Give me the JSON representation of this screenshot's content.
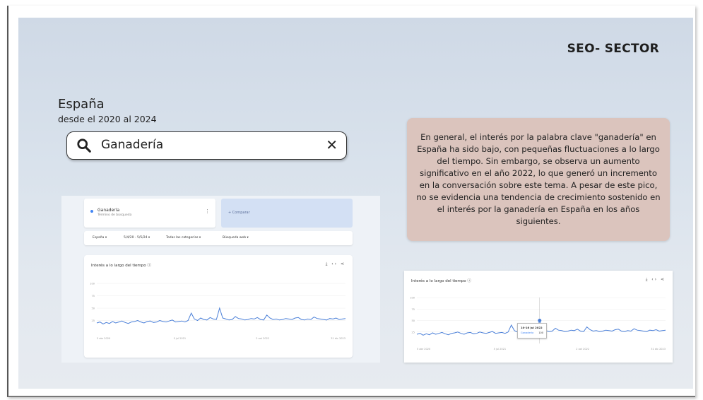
{
  "slide": {
    "heading": "SEO- SECTOR",
    "country": "España",
    "period": "desde el 2020 al 2024",
    "search": {
      "query": "Ganadería",
      "clear_symbol": "✕"
    },
    "description": "En general, el interés por la palabra clave \"ganadería\" en España ha sido bajo, con pequeñas fluctuaciones a lo largo del tiempo. Sin embargo, se observa un aumento significativo en el año 2022, lo que generó un incremento en la conversación sobre este tema. A pesar de este pico, no se evidencia una tendencia de crecimiento sostenido en el interés por la ganadería en España en los años siguientes."
  },
  "trends_main": {
    "term": "Ganadería",
    "term_sub": "Término de búsqueda",
    "compare": "+ Comparar",
    "filters": [
      "España ▾",
      "5/4/20 - 5/5/24 ▾",
      "Todas las categorías ▾",
      "Búsqueda web ▾"
    ],
    "chart_title": "Interés a lo largo del tiempo ⓘ",
    "icons": "⤓ ‹› ⋖",
    "y_ticks": [
      "100",
      "75",
      "50",
      "25"
    ],
    "x_ticks": [
      "5 abr 2020",
      "5 jul 2021",
      "2 oct 2022",
      "31 dic 2023"
    ]
  },
  "trends_zoom": {
    "chart_title": "Interés a lo largo del tiempo ⓘ",
    "icons": "⤓ ‹› ⋖",
    "tooltip": {
      "date": "10-16 jul 2022",
      "series": "Ganadería",
      "value": "100"
    },
    "y_ticks": [
      "100",
      "75",
      "50",
      "25"
    ],
    "x_ticks": [
      "5 abr 2020",
      "5 jul 2021",
      "2 oct 2022",
      "31 dic 2023"
    ]
  },
  "chart_data": {
    "type": "line",
    "series": [
      {
        "name": "Ganadería",
        "values": [
          20,
          22,
          18,
          21,
          19,
          23,
          20,
          22,
          24,
          21,
          19,
          22,
          23,
          25,
          22,
          20,
          23,
          24,
          21,
          22,
          25,
          23,
          22,
          24,
          26,
          22,
          23,
          24,
          22,
          25,
          40,
          28,
          25,
          30,
          27,
          26,
          31,
          28,
          27,
          50,
          30,
          28,
          26,
          27,
          33,
          29,
          28,
          26,
          27,
          29,
          28,
          31,
          27,
          26,
          36,
          30,
          27,
          28,
          26,
          27,
          29,
          28,
          27,
          30,
          31,
          27,
          26,
          28,
          27,
          32,
          29,
          28,
          27,
          26,
          29,
          28,
          30,
          27,
          28,
          29
        ]
      }
    ],
    "ylim": [
      0,
      100
    ],
    "color": "#4a7fd8"
  }
}
